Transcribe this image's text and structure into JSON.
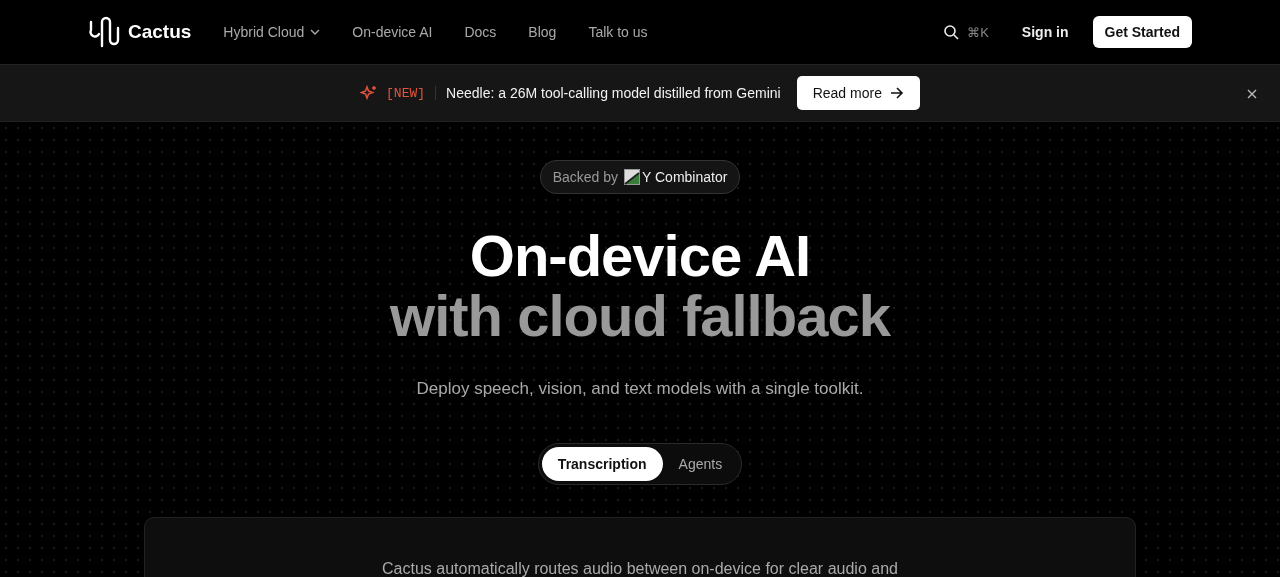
{
  "nav": {
    "brand": "Cactus",
    "links": [
      {
        "label": "Hybrid Cloud",
        "dropdown": true
      },
      {
        "label": "On-device AI",
        "dropdown": false
      },
      {
        "label": "Docs",
        "dropdown": false
      },
      {
        "label": "Blog",
        "dropdown": false
      },
      {
        "label": "Talk to us",
        "dropdown": false
      }
    ],
    "search_shortcut": "⌘K",
    "sign_in": "Sign in",
    "cta": "Get Started"
  },
  "announcement": {
    "tag": "[NEW]",
    "text": "Needle: a 26M tool-calling model distilled from Gemini",
    "button": "Read more"
  },
  "hero": {
    "badge_prefix": "Backed by",
    "badge_name": "Y Combinator",
    "title_line_1": "On-device AI",
    "title_line_2": "with cloud fallback",
    "subtitle": "Deploy speech, vision, and text models with a single toolkit.",
    "tabs": [
      {
        "label": "Transcription",
        "selected": true
      },
      {
        "label": "Agents",
        "selected": false
      }
    ],
    "card_text": "Cactus automatically routes audio between on-device for clear audio and"
  }
}
